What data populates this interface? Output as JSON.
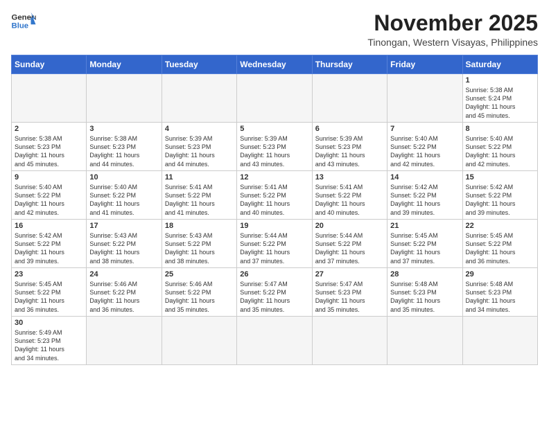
{
  "header": {
    "logo_general": "General",
    "logo_blue": "Blue",
    "month_title": "November 2025",
    "location": "Tinongan, Western Visayas, Philippines"
  },
  "weekdays": [
    "Sunday",
    "Monday",
    "Tuesday",
    "Wednesday",
    "Thursday",
    "Friday",
    "Saturday"
  ],
  "weeks": [
    [
      {
        "day": "",
        "info": ""
      },
      {
        "day": "",
        "info": ""
      },
      {
        "day": "",
        "info": ""
      },
      {
        "day": "",
        "info": ""
      },
      {
        "day": "",
        "info": ""
      },
      {
        "day": "",
        "info": ""
      },
      {
        "day": "1",
        "info": "Sunrise: 5:38 AM\nSunset: 5:24 PM\nDaylight: 11 hours\nand 45 minutes."
      }
    ],
    [
      {
        "day": "2",
        "info": "Sunrise: 5:38 AM\nSunset: 5:23 PM\nDaylight: 11 hours\nand 45 minutes."
      },
      {
        "day": "3",
        "info": "Sunrise: 5:38 AM\nSunset: 5:23 PM\nDaylight: 11 hours\nand 44 minutes."
      },
      {
        "day": "4",
        "info": "Sunrise: 5:39 AM\nSunset: 5:23 PM\nDaylight: 11 hours\nand 44 minutes."
      },
      {
        "day": "5",
        "info": "Sunrise: 5:39 AM\nSunset: 5:23 PM\nDaylight: 11 hours\nand 43 minutes."
      },
      {
        "day": "6",
        "info": "Sunrise: 5:39 AM\nSunset: 5:23 PM\nDaylight: 11 hours\nand 43 minutes."
      },
      {
        "day": "7",
        "info": "Sunrise: 5:40 AM\nSunset: 5:22 PM\nDaylight: 11 hours\nand 42 minutes."
      },
      {
        "day": "8",
        "info": "Sunrise: 5:40 AM\nSunset: 5:22 PM\nDaylight: 11 hours\nand 42 minutes."
      }
    ],
    [
      {
        "day": "9",
        "info": "Sunrise: 5:40 AM\nSunset: 5:22 PM\nDaylight: 11 hours\nand 42 minutes."
      },
      {
        "day": "10",
        "info": "Sunrise: 5:40 AM\nSunset: 5:22 PM\nDaylight: 11 hours\nand 41 minutes."
      },
      {
        "day": "11",
        "info": "Sunrise: 5:41 AM\nSunset: 5:22 PM\nDaylight: 11 hours\nand 41 minutes."
      },
      {
        "day": "12",
        "info": "Sunrise: 5:41 AM\nSunset: 5:22 PM\nDaylight: 11 hours\nand 40 minutes."
      },
      {
        "day": "13",
        "info": "Sunrise: 5:41 AM\nSunset: 5:22 PM\nDaylight: 11 hours\nand 40 minutes."
      },
      {
        "day": "14",
        "info": "Sunrise: 5:42 AM\nSunset: 5:22 PM\nDaylight: 11 hours\nand 39 minutes."
      },
      {
        "day": "15",
        "info": "Sunrise: 5:42 AM\nSunset: 5:22 PM\nDaylight: 11 hours\nand 39 minutes."
      }
    ],
    [
      {
        "day": "16",
        "info": "Sunrise: 5:42 AM\nSunset: 5:22 PM\nDaylight: 11 hours\nand 39 minutes."
      },
      {
        "day": "17",
        "info": "Sunrise: 5:43 AM\nSunset: 5:22 PM\nDaylight: 11 hours\nand 38 minutes."
      },
      {
        "day": "18",
        "info": "Sunrise: 5:43 AM\nSunset: 5:22 PM\nDaylight: 11 hours\nand 38 minutes."
      },
      {
        "day": "19",
        "info": "Sunrise: 5:44 AM\nSunset: 5:22 PM\nDaylight: 11 hours\nand 37 minutes."
      },
      {
        "day": "20",
        "info": "Sunrise: 5:44 AM\nSunset: 5:22 PM\nDaylight: 11 hours\nand 37 minutes."
      },
      {
        "day": "21",
        "info": "Sunrise: 5:45 AM\nSunset: 5:22 PM\nDaylight: 11 hours\nand 37 minutes."
      },
      {
        "day": "22",
        "info": "Sunrise: 5:45 AM\nSunset: 5:22 PM\nDaylight: 11 hours\nand 36 minutes."
      }
    ],
    [
      {
        "day": "23",
        "info": "Sunrise: 5:45 AM\nSunset: 5:22 PM\nDaylight: 11 hours\nand 36 minutes."
      },
      {
        "day": "24",
        "info": "Sunrise: 5:46 AM\nSunset: 5:22 PM\nDaylight: 11 hours\nand 36 minutes."
      },
      {
        "day": "25",
        "info": "Sunrise: 5:46 AM\nSunset: 5:22 PM\nDaylight: 11 hours\nand 35 minutes."
      },
      {
        "day": "26",
        "info": "Sunrise: 5:47 AM\nSunset: 5:22 PM\nDaylight: 11 hours\nand 35 minutes."
      },
      {
        "day": "27",
        "info": "Sunrise: 5:47 AM\nSunset: 5:23 PM\nDaylight: 11 hours\nand 35 minutes."
      },
      {
        "day": "28",
        "info": "Sunrise: 5:48 AM\nSunset: 5:23 PM\nDaylight: 11 hours\nand 35 minutes."
      },
      {
        "day": "29",
        "info": "Sunrise: 5:48 AM\nSunset: 5:23 PM\nDaylight: 11 hours\nand 34 minutes."
      }
    ],
    [
      {
        "day": "30",
        "info": "Sunrise: 5:49 AM\nSunset: 5:23 PM\nDaylight: 11 hours\nand 34 minutes."
      },
      {
        "day": "",
        "info": ""
      },
      {
        "day": "",
        "info": ""
      },
      {
        "day": "",
        "info": ""
      },
      {
        "day": "",
        "info": ""
      },
      {
        "day": "",
        "info": ""
      },
      {
        "day": "",
        "info": ""
      }
    ]
  ]
}
